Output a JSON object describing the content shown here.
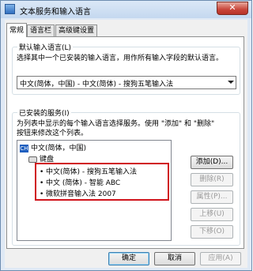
{
  "window": {
    "title": "文本服务和输入语言",
    "close_label": "✕"
  },
  "tabs": [
    {
      "label": "常规",
      "active": true
    },
    {
      "label": "语言栏",
      "active": false
    },
    {
      "label": "高级键设置",
      "active": false
    }
  ],
  "default_language": {
    "group_label": "默认输入语言(L)",
    "description": "选择其中一个已安装的输入语言，用作所有输入字段的默认语言。",
    "selected": "中文(简体，中国) - 中文(简体) - 搜狗五笔输入法"
  },
  "installed": {
    "group_label": "已安装的服务(I)",
    "description_line1": "为列表中显示的每个输入语言选择服务。使用 \"添加\" 和 \"删除\"",
    "description_line2": "按钮来修改这个列表。",
    "language_node": "中文(简体，中国)",
    "language_icon": "CH",
    "keyboard_node": "键盘",
    "services": [
      "中文(简体) - 搜狗五笔输入法",
      "中文 (简体) - 智能 ABC",
      "微软拼音输入法 2007"
    ],
    "highlight_color": "#d0141c"
  },
  "side_buttons": {
    "add": "添加(D)...",
    "remove": "删除(R)",
    "properties": "属性(P)...",
    "move_up": "上移(U)",
    "move_down": "下移(O)"
  },
  "footer_buttons": {
    "ok": "确定",
    "cancel": "取消",
    "apply": "应用(A)"
  }
}
